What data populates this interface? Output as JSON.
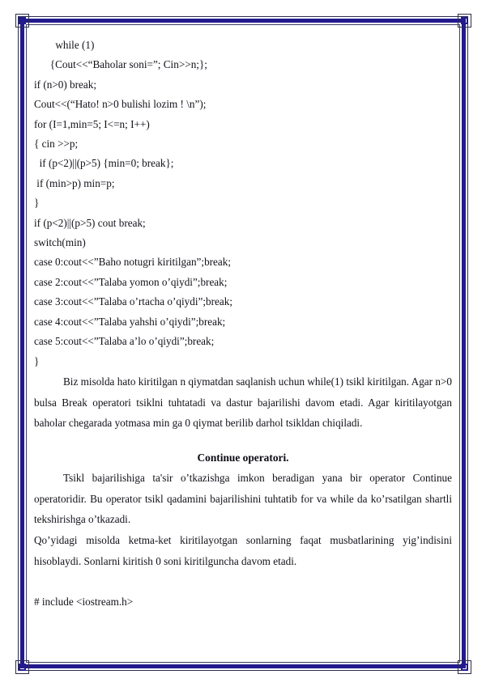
{
  "page": {
    "background_color": "#ffffff",
    "text_color": "#111119",
    "border_color": "#231a8f",
    "border_hairline_color": "#2b2b4d"
  },
  "document": {
    "code_block_1": [
      {
        "text": "        while (1)",
        "indent": "large"
      },
      {
        "text": "      {Cout<<“Baholar soni=”; Cin>>n;};",
        "indent": "large"
      },
      {
        "text": "if (n>0) break;",
        "indent": "none"
      },
      {
        "text": "Cout<<(“Hato! n>0 bulishi lozim ! \\n”);",
        "indent": "none"
      },
      {
        "text": "for (I=1,min=5; I<=n; I++)",
        "indent": "none"
      },
      {
        "text": "{ cin >>p;",
        "indent": "none"
      },
      {
        "text": "  if (p<2)||(p>5) {min=0; break};",
        "indent": "small"
      },
      {
        "text": " if (min>p) min=p;",
        "indent": "small"
      },
      {
        "text": "}",
        "indent": "none"
      },
      {
        "text": "if (p<2)||(p>5) cout break;",
        "indent": "none"
      },
      {
        "text": "switch(min)",
        "indent": "none"
      },
      {
        "text": "case 0:cout<<”Baho notugri kiritilgan”;break;",
        "indent": "none"
      },
      {
        "text": "case 2:cout<<”Talaba yomon o’qiydi”;break;",
        "indent": "none"
      },
      {
        "text": "case 3:cout<<”Talaba o’rtacha o’qiydi”;break;",
        "indent": "none"
      },
      {
        "text": "case 4:cout<<”Talaba yahshi o’qiydi”;break;",
        "indent": "none"
      },
      {
        "text": "case 5:cout<<”Talaba a’lo o’qiydi”;break;",
        "indent": "none"
      },
      {
        "text": "}",
        "indent": "none"
      }
    ],
    "paragraph_break": "Biz misolda hato kiritilgan n qiymatdan saqlanish uchun while(1) tsikl kiritilgan. Agar n>0 bulsa Break operatori tsiklni tuhtatadi va dastur bajarilishi davom etadi. Agar kiritilayotgan baholar chegarada yotmasa min ga 0 qiymat berilib darhol tsikldan chiqiladi.",
    "heading_continue": "Continue operatori.",
    "paragraph_continue_1": "Tsikl bajarilishiga ta'sir o’tkazishga imkon beradigan yana bir operator Continue operatoridir. Bu operator tsikl qadamini bajarilishini tuhtatib for va while da ko’rsatilgan shartli tekshirishga o’tkazadi.",
    "paragraph_continue_2": "Qo’yidagi misolda ketma-ket kiritilayotgan sonlarning faqat musbatlarining yig’indisini hisoblaydi. Sonlarni kiritish 0 soni kiritilguncha davom etadi.",
    "code_block_2": [
      {
        "text": "# include <iostream.h>",
        "indent": "none"
      }
    ]
  }
}
